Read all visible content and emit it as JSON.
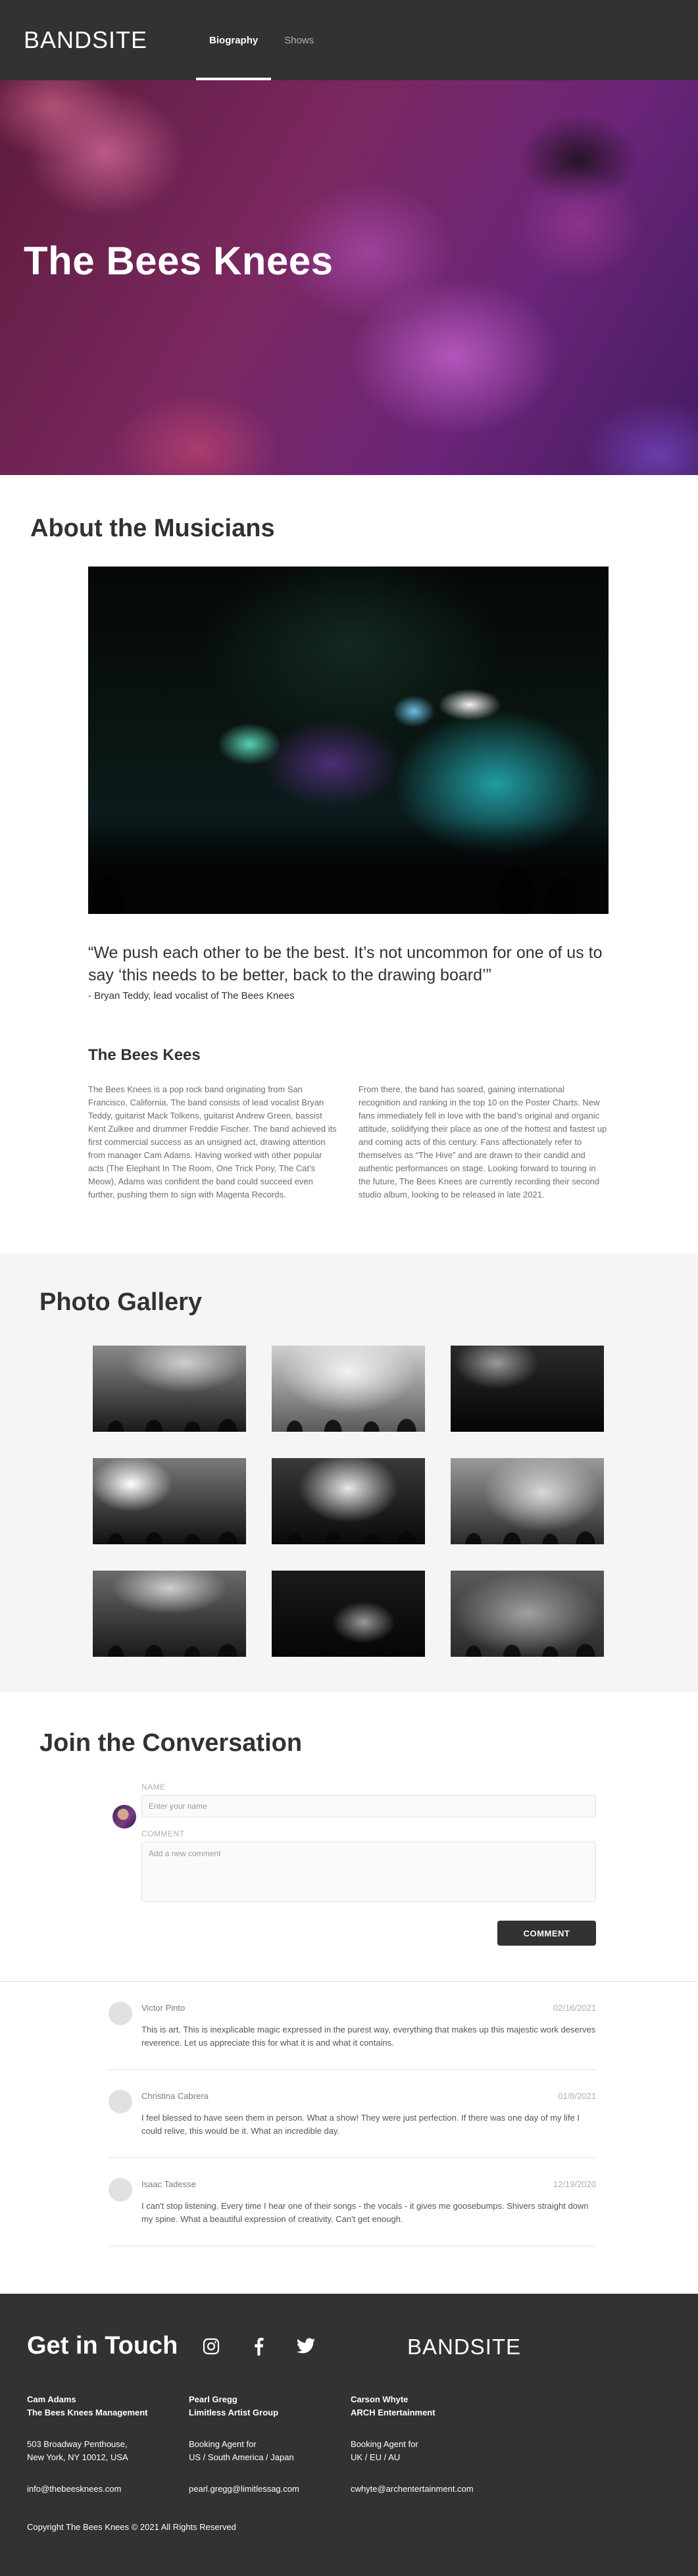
{
  "nav": {
    "logo": "BANDSITE",
    "links": [
      {
        "label": "Biography",
        "active": true
      },
      {
        "label": "Shows",
        "active": false
      }
    ]
  },
  "hero": {
    "title": "The Bees Knees"
  },
  "about": {
    "title": "About the Musicians",
    "quote": "“We push each other to be the best. It’s not uncommon for one of us to say ‘this needs to be better, back to the drawing board’”",
    "quote_author": "- Bryan Teddy, lead vocalist of The Bees Knees",
    "bio_title": "The Bees Kees",
    "bio_left": "The Bees Knees is a pop rock band originating from San Francisco, California. The band consists of lead vocalist Bryan Teddy, guitarist Mack Tolkens, guitarist Andrew Green, bassist Kent Zulkee and drummer Freddie Fischer. The band achieved its first commercial success as an unsigned act, drawing attention from manager Cam Adams. Having worked with other popular acts (The Elephant In The Room, One Trick Pony, The Cat’s Meow), Adams was confident the band could succeed even further, pushing them to sign with Magenta Records.",
    "bio_right": "From there, the band has soared, gaining international recognition and ranking in the top 10 on the Poster Charts. New fans immediately fell in love with the band’s original and organic attitude, solidifying their place as one of the hottest and fastest up and coming acts of this century. Fans affectionately refer to themselves as “The Hive” and are drawn to their candid and authentic performances on stage. Looking forward to touring in the future, The Bees Knees are currently recording their second studio album, looking to be released in late 2021."
  },
  "gallery": {
    "title": "Photo Gallery",
    "count": 9
  },
  "conversation": {
    "title": "Join the Conversation",
    "name_label": "NAME",
    "name_placeholder": "Enter your name",
    "comment_label": "COMMENT",
    "comment_placeholder": "Add a new comment",
    "button_label": "COMMENT",
    "comments": [
      {
        "name": "Victor Pinto",
        "date": "02/16/2021",
        "text": "This is art. This is inexplicable magic expressed in the purest way, everything that makes up this majestic work deserves reverence. Let us appreciate this for what it is and what it contains."
      },
      {
        "name": "Christina Cabrera",
        "date": "01/8/2021",
        "text": "I feel blessed to have seen them in person. What a show! They were just perfection. If there was one day of my life I could relive, this would be it. What an incredible day."
      },
      {
        "name": "Isaac Tadesse",
        "date": "12/19/2020",
        "text": "I can't stop listening. Every time I hear one of their songs - the vocals - it gives me goosebumps. Shivers straight down my spine. What a beautiful expression of creativity. Can't get enough."
      }
    ]
  },
  "footer": {
    "title": "Get in Touch",
    "logo": "BANDSITE",
    "social": [
      "instagram-icon",
      "facebook-icon",
      "twitter-icon"
    ],
    "contacts": [
      {
        "name": "Cam Adams",
        "org": "The Bees Knees Management",
        "line1": "503 Broadway Penthouse,",
        "line2": "New York, NY 10012, USA",
        "email": "info@thebeesknees.com"
      },
      {
        "name": "Pearl Gregg",
        "org": "Limitless Artist Group",
        "line1": "Booking Agent for",
        "line2": "US / South America / Japan",
        "email": "pearl.gregg@limitlessag.com"
      },
      {
        "name": "Carson Whyte",
        "org": "ARCH Entertainment",
        "line1": "Booking Agent for",
        "line2": "UK / EU / AU",
        "email": "cwhyte@archentertainment.com"
      }
    ],
    "copyright": "Copyright The Bees Knees © 2021 All Rights Reserved"
  },
  "colors": {
    "dark": "#323232",
    "light_bg": "#f5f5f5",
    "border": "#e1e1e1",
    "muted": "#afafaf"
  }
}
